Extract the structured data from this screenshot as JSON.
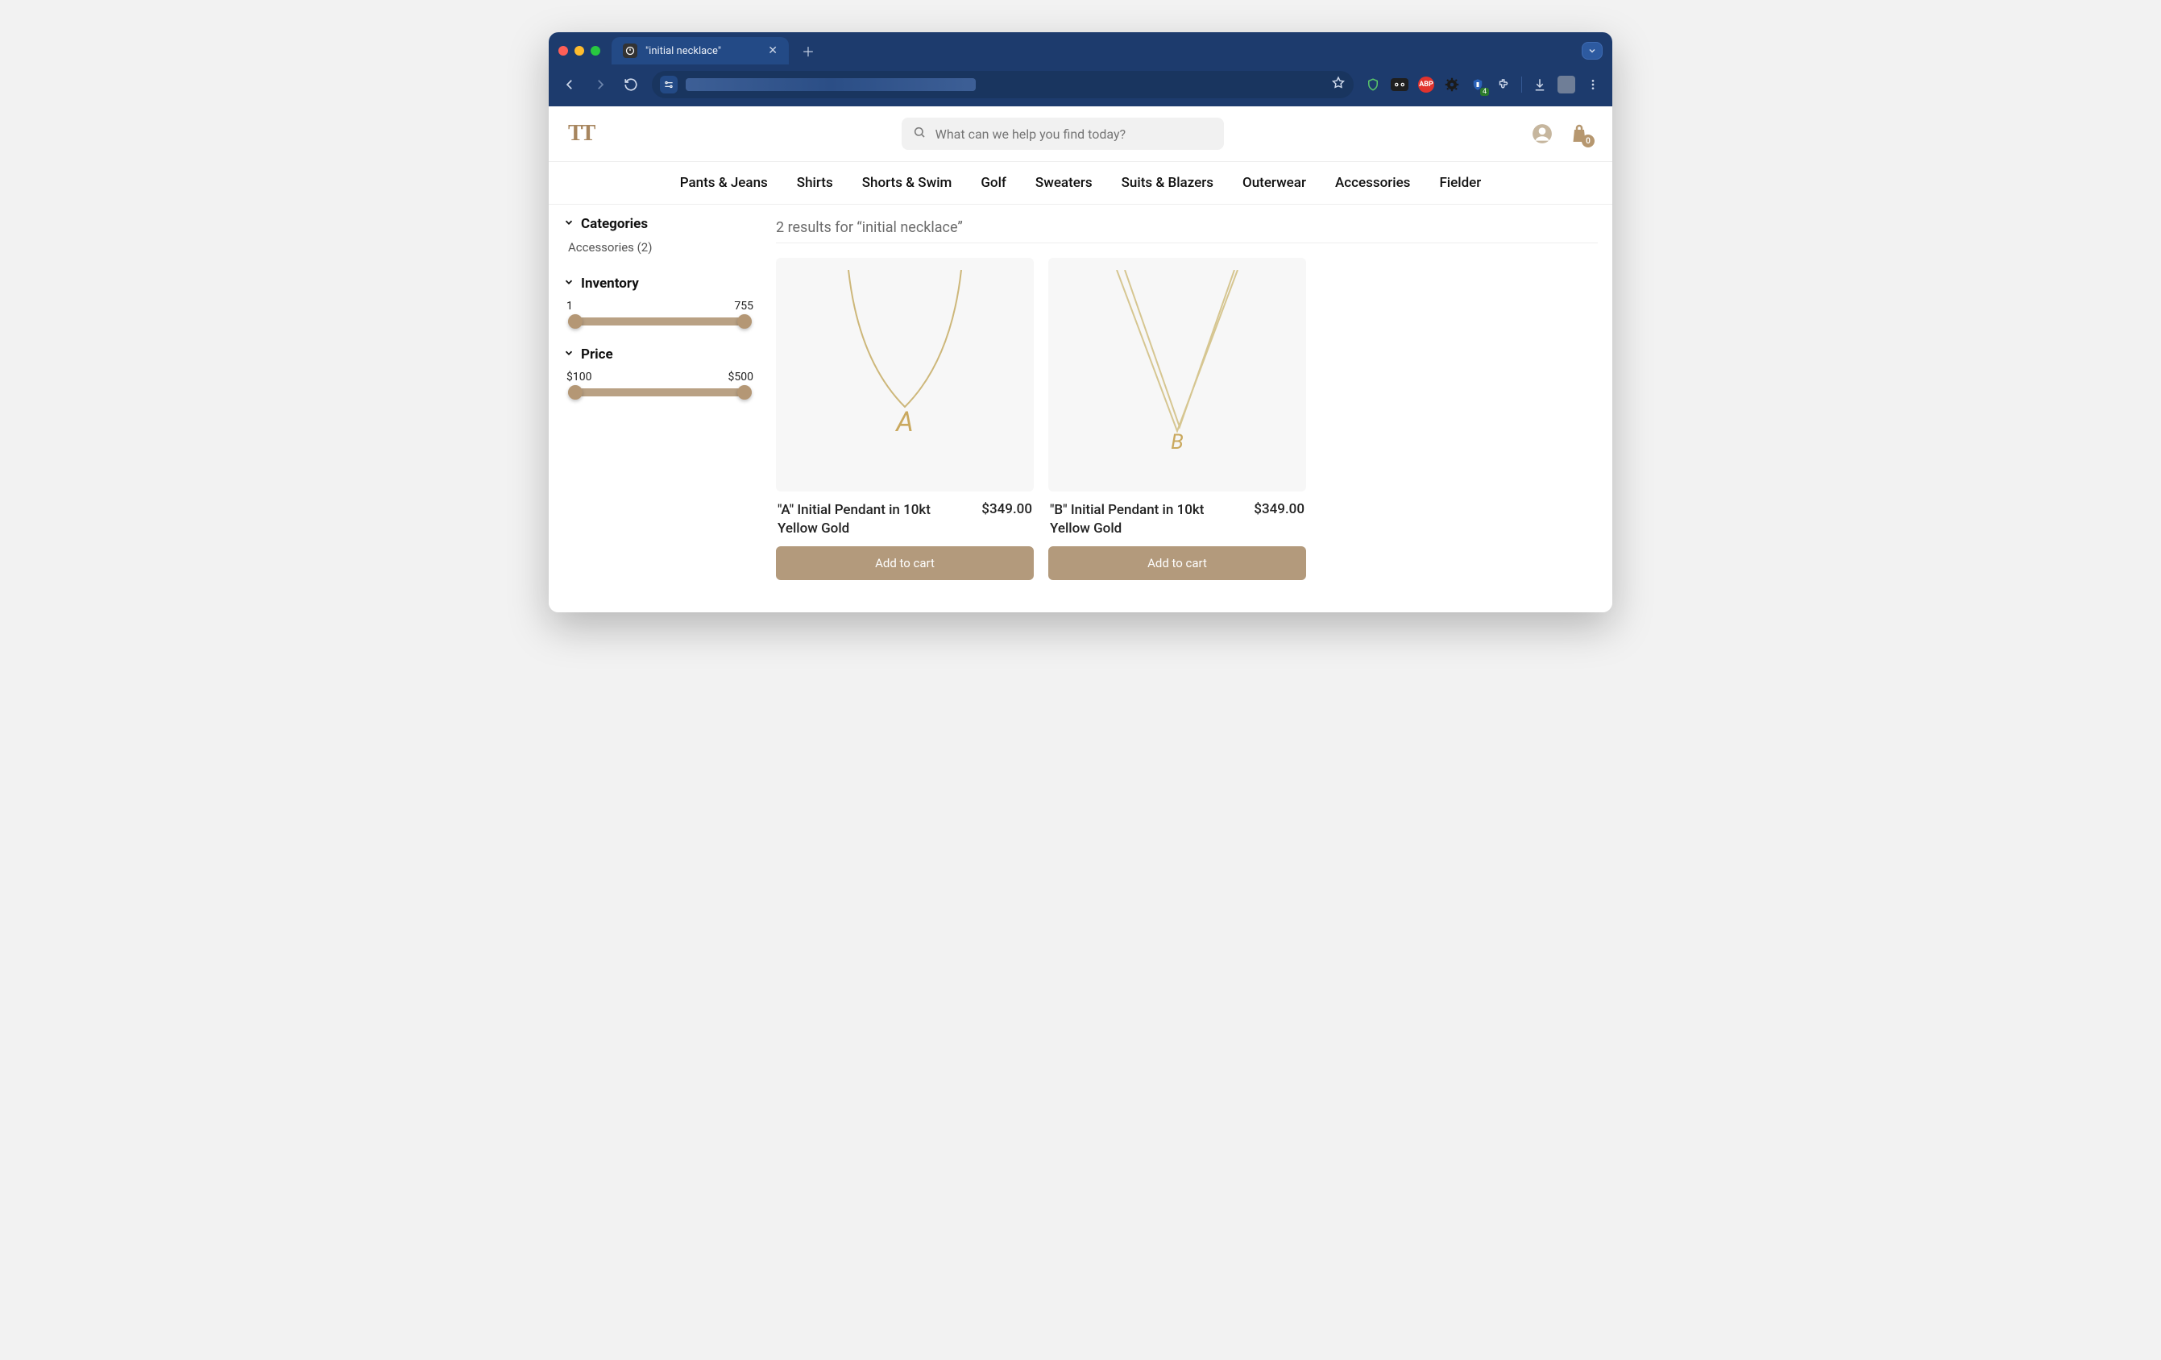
{
  "browser": {
    "tab_title": "\"initial necklace\"",
    "shield_badge": "4"
  },
  "site": {
    "search_placeholder": "What can we help you find today?",
    "cart_count": "0",
    "nav": [
      "Pants & Jeans",
      "Shirts",
      "Shorts & Swim",
      "Golf",
      "Sweaters",
      "Suits & Blazers",
      "Outerwear",
      "Accessories",
      "Fielder"
    ]
  },
  "sidebar": {
    "categories_label": "Categories",
    "category_item": "Accessories (2)",
    "inventory_label": "Inventory",
    "inventory_min": "1",
    "inventory_max": "755",
    "price_label": "Price",
    "price_min": "$100",
    "price_max": "$500"
  },
  "results": {
    "title": "2 results for “initial necklace”",
    "add_label": "Add to cart",
    "items": [
      {
        "name": "\"A\" Initial Pendant in 10kt Yellow Gold",
        "price": "$349.00",
        "letter": "A"
      },
      {
        "name": "\"B\" Initial Pendant in 10kt Yellow Gold",
        "price": "$349.00",
        "letter": "B"
      }
    ]
  }
}
